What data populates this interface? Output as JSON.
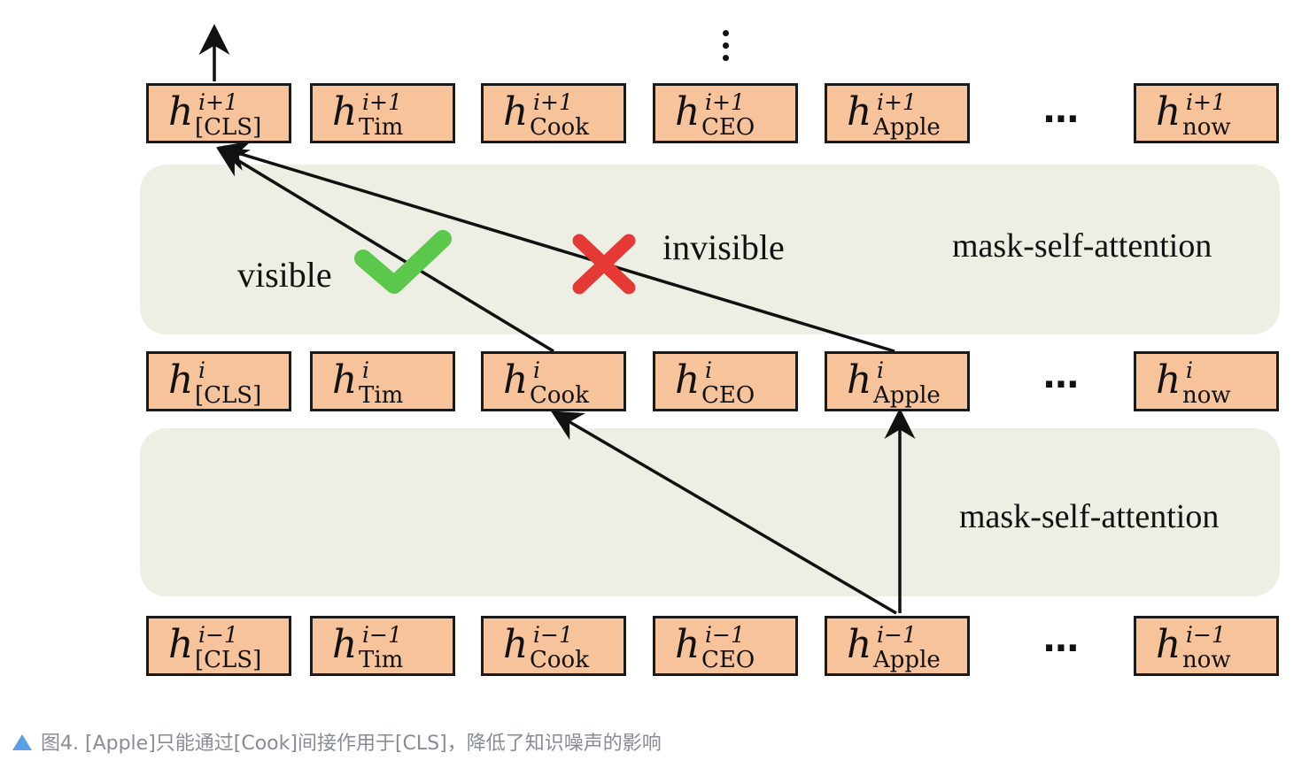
{
  "layers": [
    {
      "id": "top",
      "superscript": "i+1",
      "tokens": [
        "[CLS]",
        "Tim",
        "Cook",
        "CEO",
        "Apple",
        "now"
      ]
    },
    {
      "id": "middle",
      "superscript": "i",
      "tokens": [
        "[CLS]",
        "Tim",
        "Cook",
        "CEO",
        "Apple",
        "now"
      ]
    },
    {
      "id": "bottom",
      "superscript": "i−1",
      "tokens": [
        "[CLS]",
        "Tim",
        "Cook",
        "CEO",
        "Apple",
        "now"
      ]
    }
  ],
  "symbol": "h",
  "ellipsis": "⋯",
  "attention_label_upper": "mask-self-attention",
  "attention_label_lower": "mask-self-attention",
  "visible_label": "visible",
  "invisible_label": "invisible",
  "colors": {
    "box_fill": "#f6c39b",
    "band_fill": "#edefe4",
    "check": "#5cc84b",
    "cross": "#e53935"
  },
  "caption": {
    "text": "图4. [Apple]只能通过[Cook]间接作用于[CLS]，降低了知识噪声的影响"
  }
}
